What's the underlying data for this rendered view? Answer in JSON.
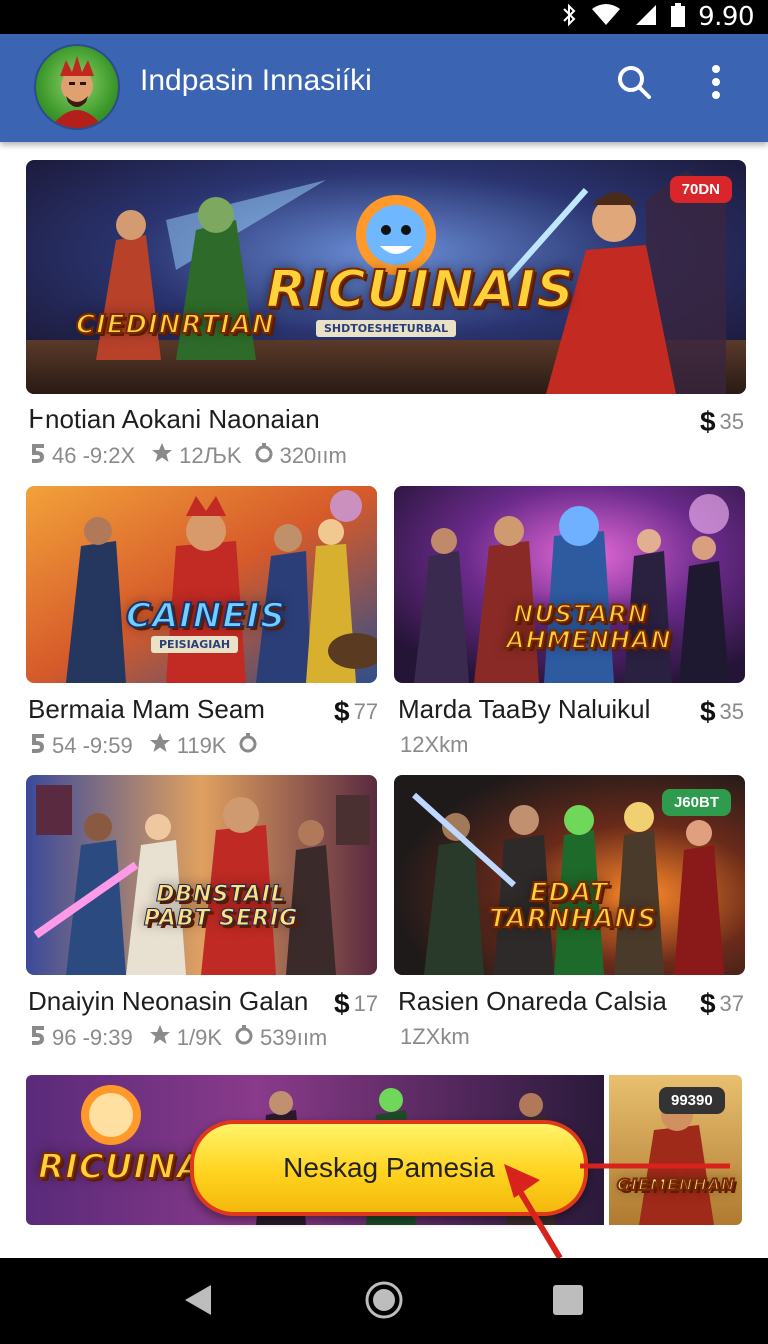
{
  "status_bar": {
    "time": "9.90"
  },
  "app_bar": {
    "title": "Indpasin Innasiíki"
  },
  "cards": [
    {
      "title": "Ͱnotian Aokani Naonaian",
      "meta_a": "46 -9:2X",
      "meta_b": "12ЉK",
      "meta_c": "320ıım",
      "price": "35",
      "badge": "70DN",
      "art_title": "RICUINAIS",
      "art_sub": "SHDTOESHETURBAL",
      "art_left": "CIEDINRTIAN"
    },
    {
      "title": "Bermaia Mam Seam",
      "meta_a": "54 -9:59",
      "meta_b": "119K",
      "price": "77",
      "art_title": "CAINEIS",
      "art_sub": "PEISIAGIAH"
    },
    {
      "title": "Marda TaaBy Naluikul",
      "meta_a": "12Xkm",
      "price": "35",
      "art_title": "NUSTARN AHMENHAN"
    },
    {
      "title": "Dnaiyin Neonasin Galan",
      "meta_a": "96 -9:39",
      "meta_b": "1/9K",
      "meta_c": "539ıım",
      "price": "17",
      "art_title": "DBNSTAIL PABT SERIG"
    },
    {
      "title": "Rasien Onareda Calsia",
      "meta_a": "1ZXkm",
      "price": "37",
      "badge": "J60BT",
      "art_title": "EDAT TARNHANS"
    }
  ],
  "promo": {
    "cta_label": "Neskag Pamesia",
    "badge": "99390",
    "art_title": "RICUINAIS",
    "art_right": "GIEMENHAN"
  },
  "colors": {
    "app_bar": "#3b64b3",
    "cta_border": "#e0391a",
    "badge_red": "#d9262a",
    "badge_green": "#2f9b4c"
  }
}
